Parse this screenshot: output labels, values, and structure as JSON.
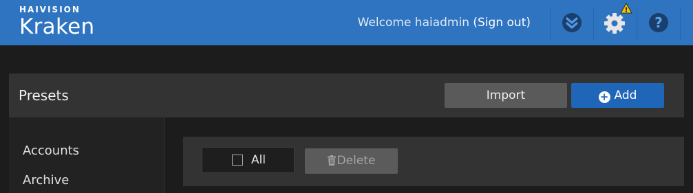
{
  "header": {
    "brand_small": "HAIVISION",
    "brand_name": "Kraken",
    "welcome_text": "Welcome haiadmin",
    "signout_label": "(Sign out)",
    "icons": [
      "haivision-logo-icon",
      "gear-icon",
      "warning-icon",
      "help-icon"
    ],
    "help_glyph": "?",
    "warning_glyph": "!"
  },
  "presets": {
    "title": "Presets",
    "import_label": "Import",
    "add_label": "Add",
    "add_glyph": "+"
  },
  "sidebar": {
    "items": [
      {
        "label": "Accounts"
      },
      {
        "label": "Archive"
      }
    ]
  },
  "toolbar": {
    "all_label": "All",
    "delete_label": "Delete"
  },
  "colors": {
    "header_blue": "#2f74c0",
    "primary_button": "#1f66b8",
    "warning_yellow": "#f2c400"
  }
}
